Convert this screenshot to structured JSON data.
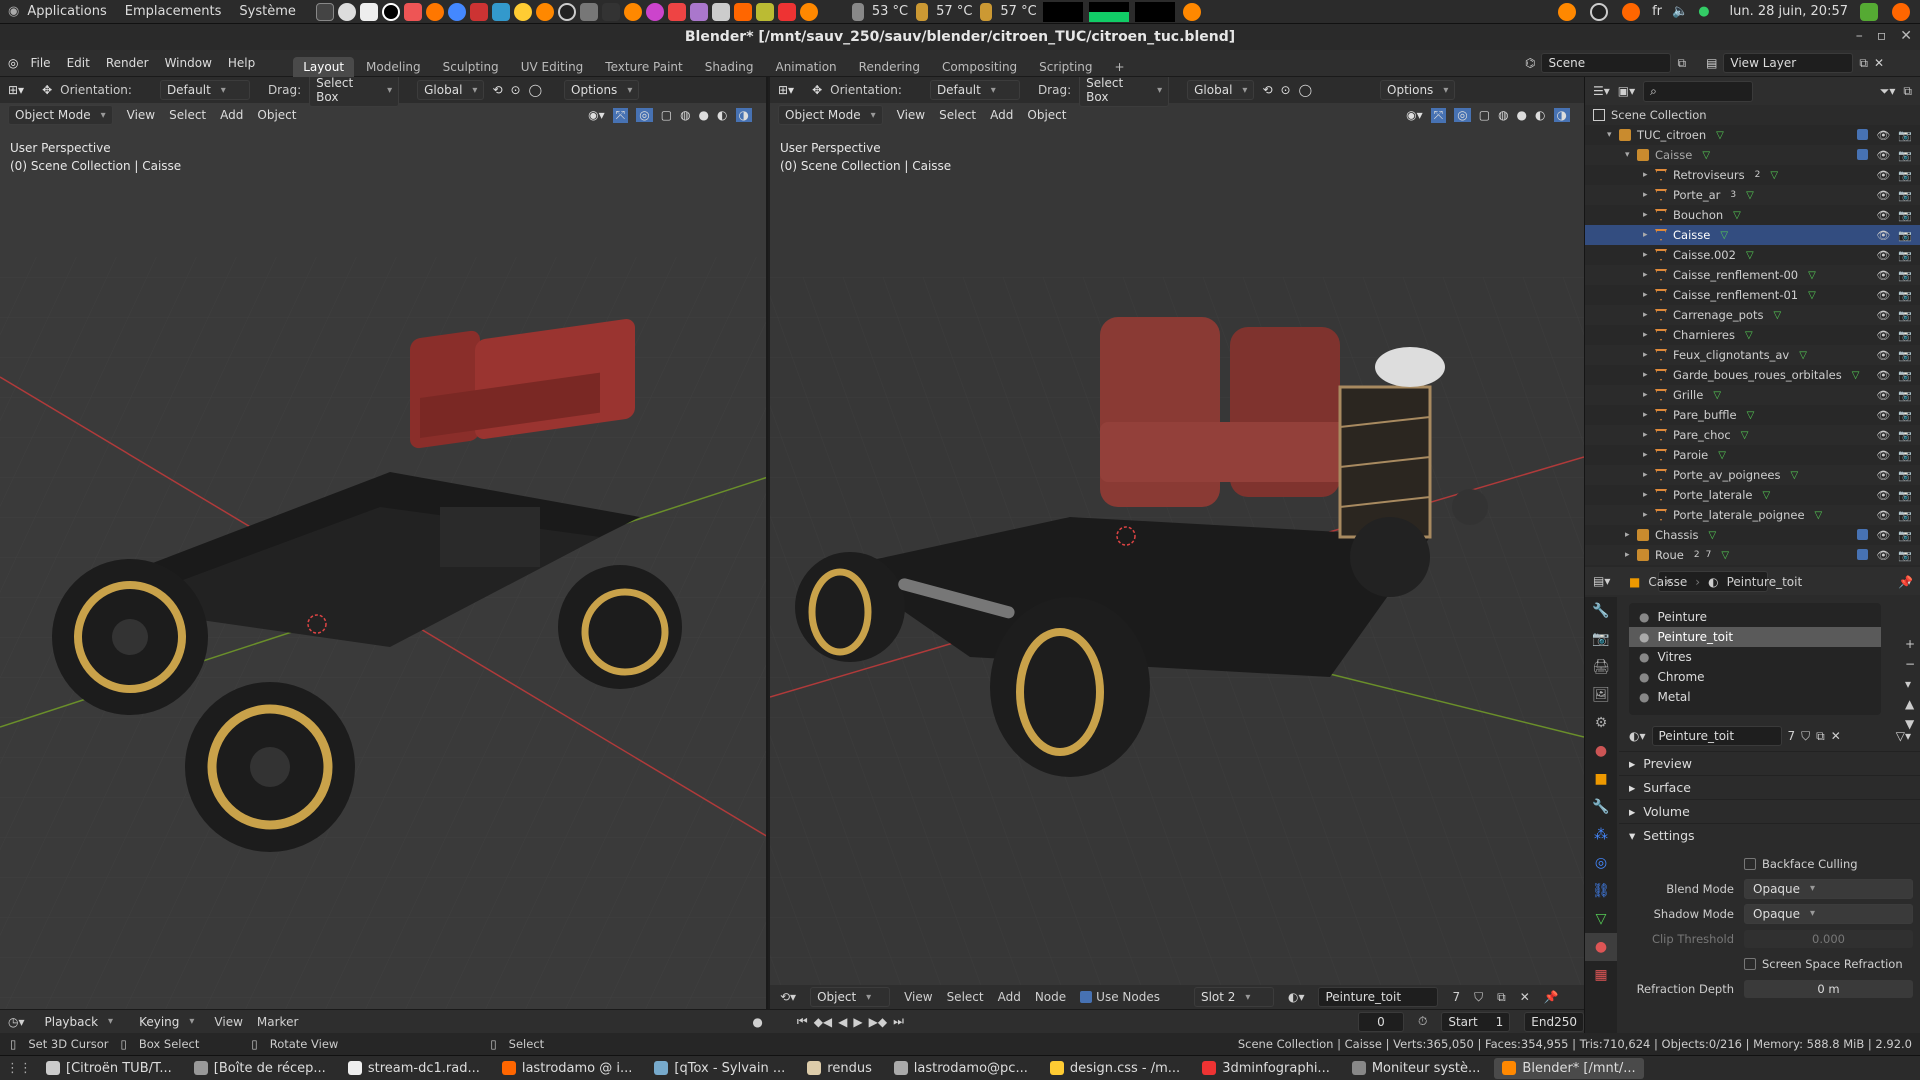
{
  "os_panel": {
    "menus": [
      "Applications",
      "Emplacements",
      "Système"
    ],
    "temps": [
      "53 °C",
      "57 °C",
      "57 °C"
    ],
    "lang": "fr",
    "datetime": "lun. 28 juin, 20:57"
  },
  "window": {
    "title": "Blender* [/mnt/sauv_250/sauv/blender/citroen_TUC/citroen_tuc.blend]"
  },
  "topbar": {
    "menus": [
      "File",
      "Edit",
      "Render",
      "Window",
      "Help"
    ],
    "workspaces": [
      "Layout",
      "Modeling",
      "Sculpting",
      "UV Editing",
      "Texture Paint",
      "Shading",
      "Animation",
      "Rendering",
      "Compositing",
      "Scripting"
    ],
    "active_workspace": "Layout",
    "scene": "Scene",
    "view_layer": "View Layer"
  },
  "viewport_left": {
    "orientation_label": "Orientation:",
    "orientation": "Default",
    "drag_label": "Drag:",
    "drag": "Select Box",
    "transform": "Global",
    "options": "Options",
    "mode": "Object Mode",
    "menus": [
      "View",
      "Select",
      "Add",
      "Object"
    ],
    "info_line1": "User Perspective",
    "info_line2": "(0) Scene Collection | Caisse"
  },
  "viewport_right": {
    "orientation_label": "Orientation:",
    "orientation": "Default",
    "drag_label": "Drag:",
    "drag": "Select Box",
    "transform": "Global",
    "options": "Options",
    "mode": "Object Mode",
    "menus": [
      "View",
      "Select",
      "Add",
      "Object"
    ],
    "info_line1": "User Perspective",
    "info_line2": "(0) Scene Collection | Caisse",
    "shader_bar": {
      "mode": "Object",
      "menus": [
        "View",
        "Select",
        "Add",
        "Node"
      ],
      "use_nodes": "Use Nodes",
      "slot": "Slot 2",
      "material": "Peinture_toit",
      "users": "7"
    }
  },
  "outliner": {
    "root": "Scene Collection",
    "items": [
      {
        "name": "TUC_citroen",
        "level": 0
      },
      {
        "name": "Caisse",
        "level": 1
      },
      {
        "name": "Retroviseurs",
        "level": 2,
        "badge": "2"
      },
      {
        "name": "Porte_ar",
        "level": 2,
        "badge": "3"
      },
      {
        "name": "Bouchon",
        "level": 2
      },
      {
        "name": "Caisse",
        "level": 2,
        "selected": true
      },
      {
        "name": "Caisse.002",
        "level": 2
      },
      {
        "name": "Caisse_renflement-00",
        "level": 2
      },
      {
        "name": "Caisse_renflement-01",
        "level": 2
      },
      {
        "name": "Carrenage_pots",
        "level": 2
      },
      {
        "name": "Charnieres",
        "level": 2
      },
      {
        "name": "Feux_clignotants_av",
        "level": 2
      },
      {
        "name": "Garde_boues_roues_orbitales",
        "level": 2
      },
      {
        "name": "Grille",
        "level": 2
      },
      {
        "name": "Pare_buffle",
        "level": 2
      },
      {
        "name": "Pare_choc",
        "level": 2
      },
      {
        "name": "Paroie",
        "level": 2
      },
      {
        "name": "Porte_av_poignees",
        "level": 2
      },
      {
        "name": "Porte_laterale",
        "level": 2
      },
      {
        "name": "Porte_laterale_poignee",
        "level": 2
      },
      {
        "name": "Chassis",
        "level": 1
      },
      {
        "name": "Roue",
        "level": 1,
        "badge": "2",
        "badge2": "7"
      }
    ]
  },
  "properties": {
    "object": "Caisse",
    "material": "Peinture_toit",
    "slots": [
      "Peinture",
      "Peinture_toit",
      "Vitres",
      "Chrome",
      "Metal"
    ],
    "active_slot": "Peinture_toit",
    "material_field": "Peinture_toit",
    "material_users": "7",
    "panels": [
      "Preview",
      "Surface",
      "Volume",
      "Settings"
    ],
    "backface_culling": "Backface Culling",
    "blend_mode_label": "Blend Mode",
    "blend_mode": "Opaque",
    "shadow_mode_label": "Shadow Mode",
    "shadow_mode": "Opaque",
    "clip_threshold_label": "Clip Threshold",
    "clip_threshold": "0.000",
    "ssr": "Screen Space Refraction",
    "refraction_depth_label": "Refraction Depth",
    "refraction_depth": "0 m"
  },
  "timeline": {
    "menus": [
      "Playback",
      "Keying",
      "View",
      "Marker"
    ],
    "frame": "0",
    "start_label": "Start",
    "start": "1",
    "end_label": "End",
    "end": "250"
  },
  "statusbar": {
    "items": [
      "Set 3D Cursor",
      "Box Select",
      "Rotate View",
      "Select"
    ],
    "stats": "Scene Collection | Caisse | Verts:365,050 | Faces:354,955 | Tris:710,624 | Objects:0/216 | Memory: 588.8 MiB | 2.92.0"
  },
  "taskbar": {
    "tasks": [
      "[Citroën TUB/T...",
      "[Boîte de récep...",
      "stream-dc1.rad...",
      "lastrodamo @ i...",
      "[qTox - Sylvain ...",
      "rendus",
      "lastrodamo@pc...",
      "design.css - /m...",
      "3dminfographi...",
      "Moniteur systè...",
      "Blender* [/mnt/..."
    ]
  }
}
